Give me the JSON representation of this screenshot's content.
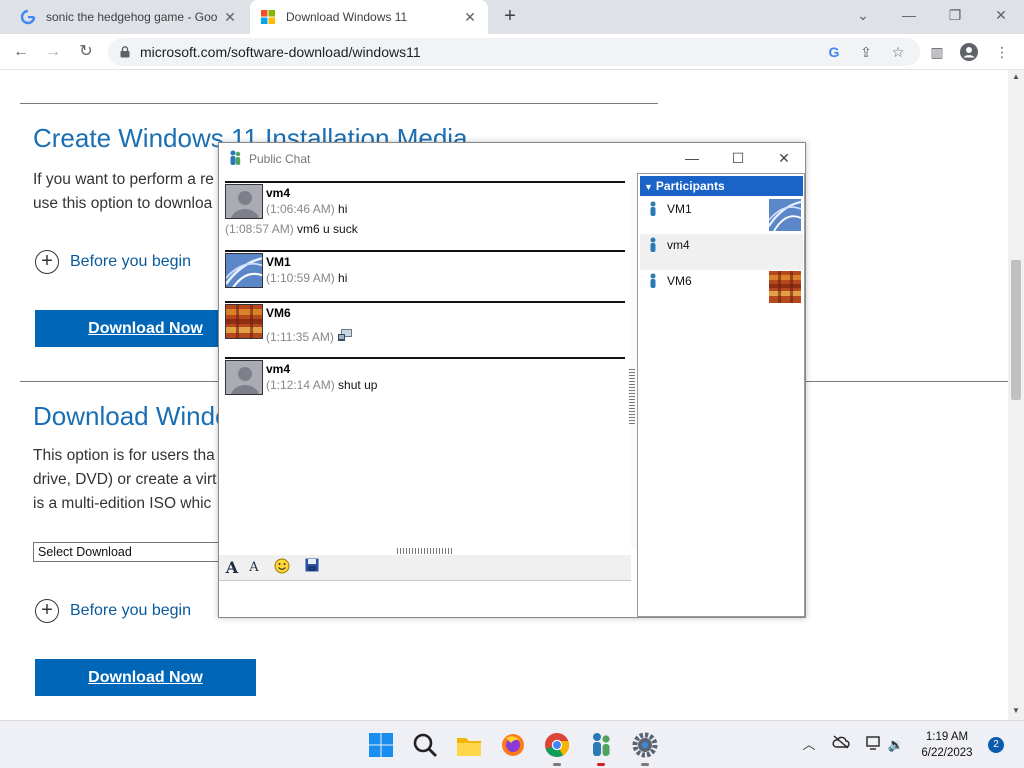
{
  "browser": {
    "tabs": [
      {
        "title": "sonic the hedgehog game - Goo",
        "active": false
      },
      {
        "title": "Download Windows 11",
        "active": true
      }
    ],
    "new_tab": "+",
    "url": "microsoft.com/software-download/windows11"
  },
  "page": {
    "section1": {
      "heading": "Create Windows 11 Installation Media",
      "text_line1": "If you want to perform a re",
      "text_line2": "use this option to downloa",
      "expander": "Before you begin",
      "button": "Download Now"
    },
    "section2": {
      "heading": "Download Windo",
      "text_line1": "This option is for users tha",
      "text_line2": "drive, DVD) or create a virt",
      "text_line3": "is a multi-edition ISO whic",
      "select_value": "Select Download",
      "expander": "Before you begin",
      "button": "Download Now"
    }
  },
  "chat": {
    "window_title": "Public Chat",
    "messages": [
      {
        "sender": "vm4",
        "time": "(1:06:46 AM)",
        "text": "hi",
        "followup_time": "(1:08:57 AM)",
        "followup_text": "vm6 u suck"
      },
      {
        "sender": "VM1",
        "time": "(1:10:59 AM)",
        "text": "hi"
      },
      {
        "sender": "VM6",
        "time": "(1:11:35 AM)",
        "text": ""
      },
      {
        "sender": "vm4",
        "time": "(1:12:14 AM)",
        "text": "shut up"
      }
    ],
    "participants_header": "Participants",
    "participants": [
      "VM1",
      "vm4",
      "VM6"
    ]
  },
  "taskbar": {
    "time": "1:19 AM",
    "date": "6/22/2023",
    "notifications": "2"
  },
  "colors": {
    "ms_blue": "#0067b8",
    "heading_blue": "#1a6fb4",
    "participants_header": "#1a63c7"
  }
}
